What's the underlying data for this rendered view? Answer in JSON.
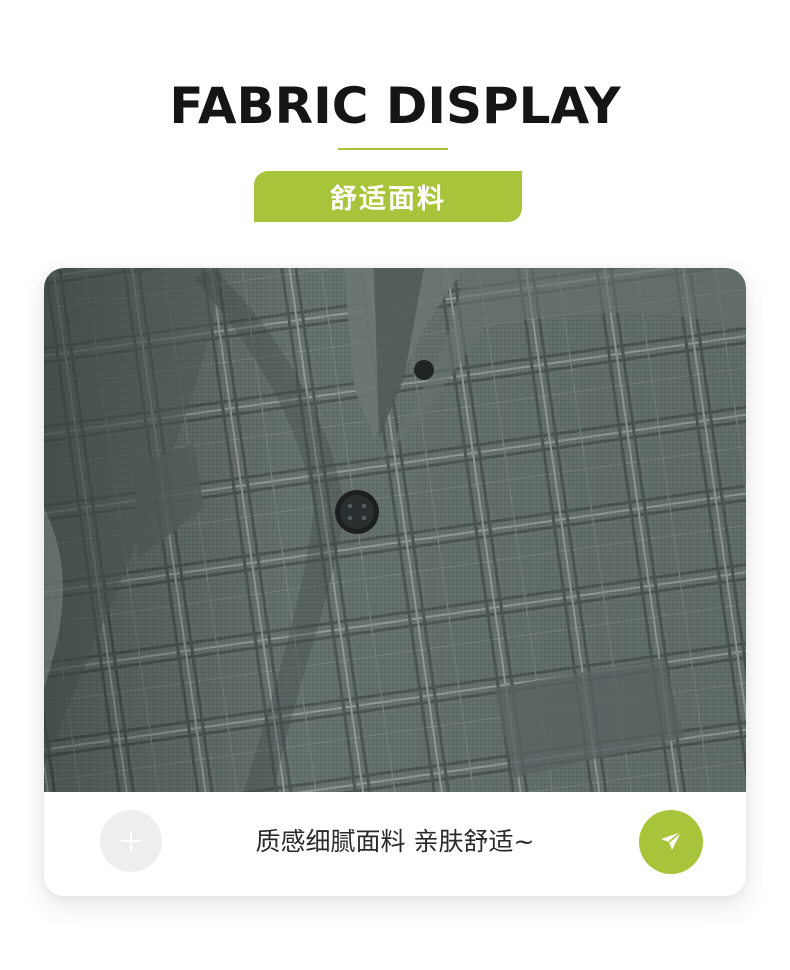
{
  "header": {
    "title": "FABRIC DISPLAY",
    "subtitle_pill": "舒适面料"
  },
  "card": {
    "image_alt": "fabric-closeup-photo",
    "caption": "质感细腻面料 亲肤舒适~",
    "plus_icon": "plus-icon",
    "send_icon": "paper-plane-icon"
  },
  "colors": {
    "accent": "#a7c43a",
    "title_text": "#151515",
    "caption_text": "#2a2a2a",
    "fabric_base": "#5f6b6a",
    "plus_bg": "#eeeeee"
  }
}
